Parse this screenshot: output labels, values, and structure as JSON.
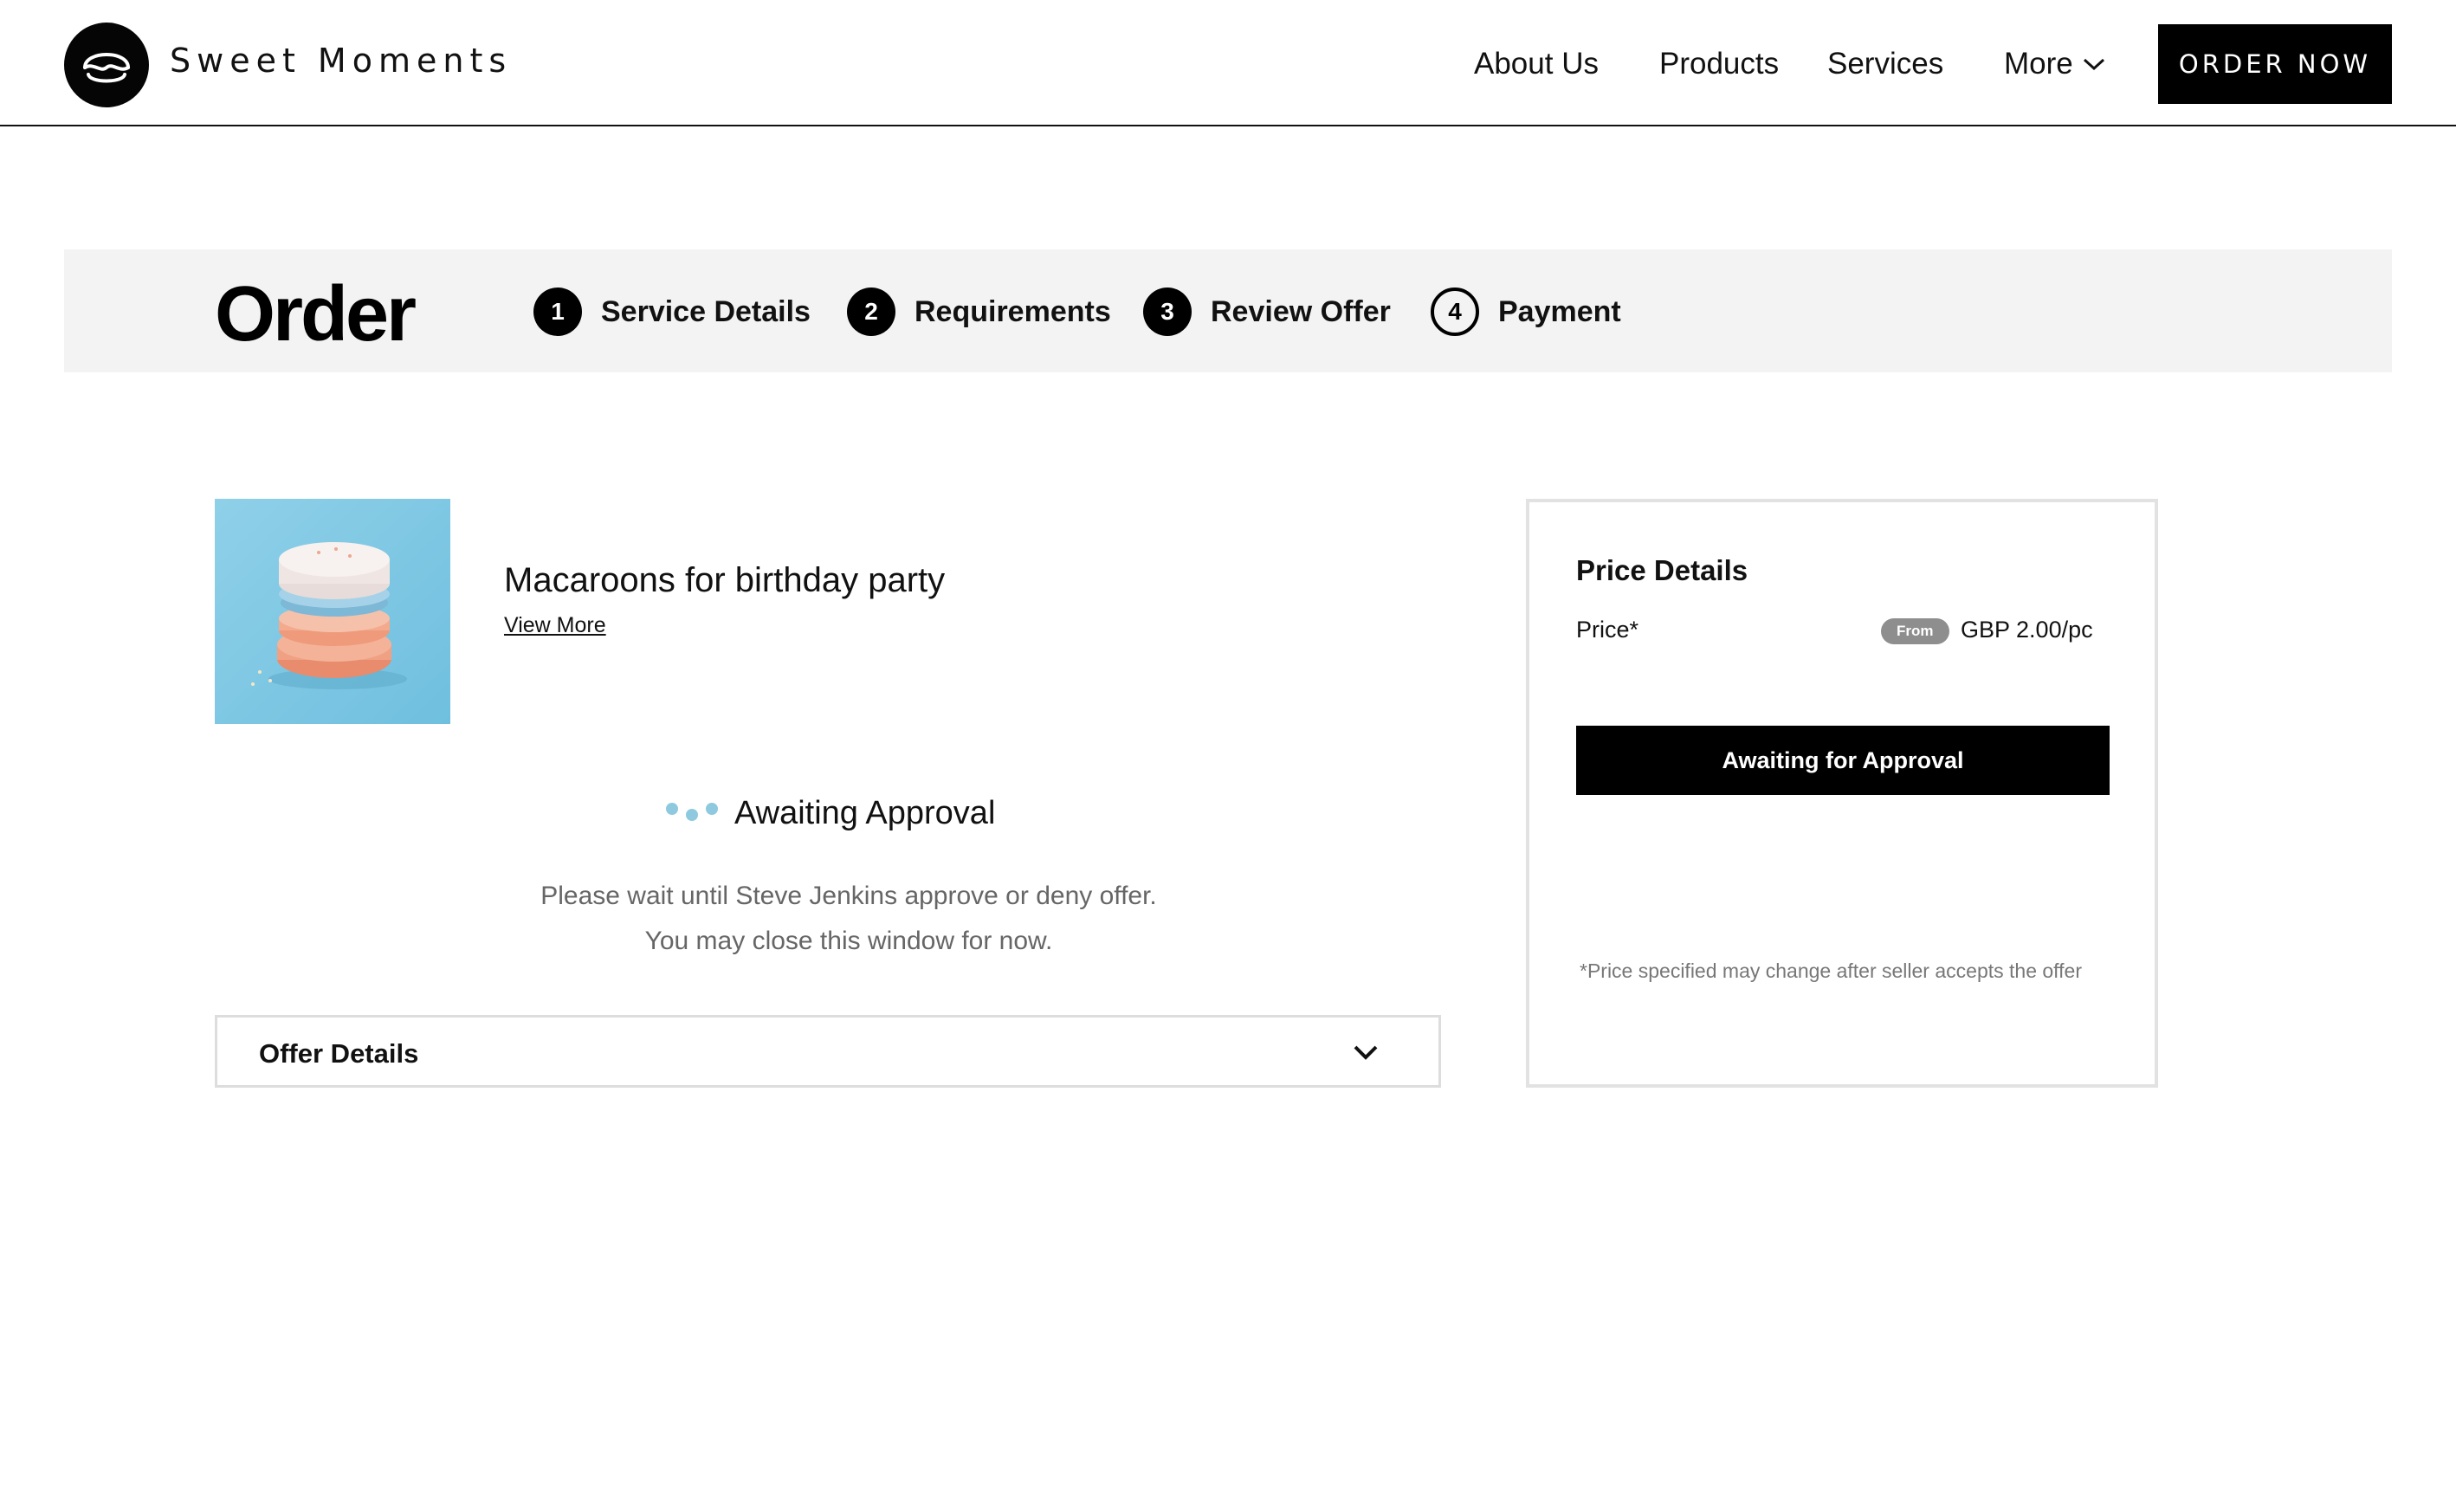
{
  "header": {
    "brand": "Sweet Moments",
    "nav": {
      "about": "About Us",
      "products": "Products",
      "services": "Services",
      "more": "More"
    },
    "cta": "ORDER NOW"
  },
  "steps": {
    "title": "Order",
    "items": [
      {
        "num": "1",
        "label": "Service Details"
      },
      {
        "num": "2",
        "label": "Requirements"
      },
      {
        "num": "3",
        "label": "Review Offer"
      },
      {
        "num": "4",
        "label": "Payment"
      }
    ]
  },
  "product": {
    "title": "Macaroons for birthday party",
    "view_more": "View More"
  },
  "status": {
    "title": "Awaiting Approval",
    "message_line1": "Please wait until Steve Jenkins approve or deny offer.",
    "message_line2": "You may close this window for now."
  },
  "offer_details": {
    "label": "Offer Details"
  },
  "price_card": {
    "heading": "Price Details",
    "price_label": "Price*",
    "from_badge": "From",
    "price_value": "GBP 2.00/pc",
    "button": "Awaiting for Approval",
    "note": "*Price specified may change after seller accepts the offer"
  },
  "colors": {
    "accent": "#000000",
    "steps_bg": "#f3f3f3",
    "dots": "#8ec9df",
    "badge": "#8e8e8e"
  }
}
